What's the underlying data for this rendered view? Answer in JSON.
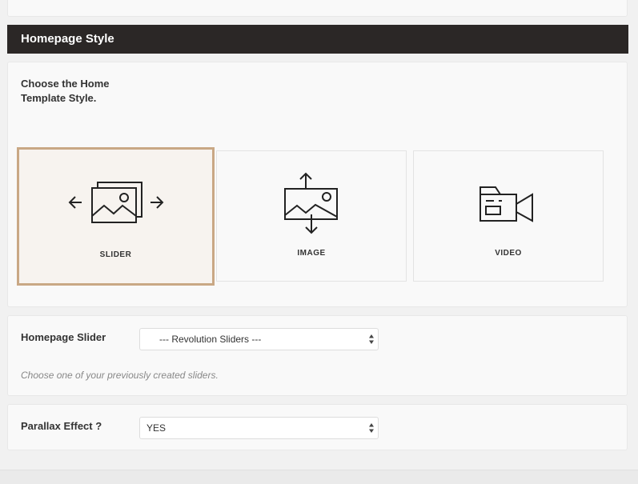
{
  "header": {
    "title": "Homepage Style"
  },
  "style_section": {
    "label": "Choose the Home Template Style.",
    "options": [
      {
        "label": "SLIDER",
        "icon": "slider-icon",
        "selected": true
      },
      {
        "label": "IMAGE",
        "icon": "image-icon",
        "selected": false
      },
      {
        "label": "VIDEO",
        "icon": "video-icon",
        "selected": false
      }
    ],
    "selected_border_color": "#c9a885"
  },
  "slider_section": {
    "label": "Homepage Slider",
    "select_value": "--- Revolution Sliders ---",
    "help": "Choose one of your previously created sliders."
  },
  "parallax_section": {
    "label": "Parallax Effect ?",
    "select_value": "YES"
  }
}
